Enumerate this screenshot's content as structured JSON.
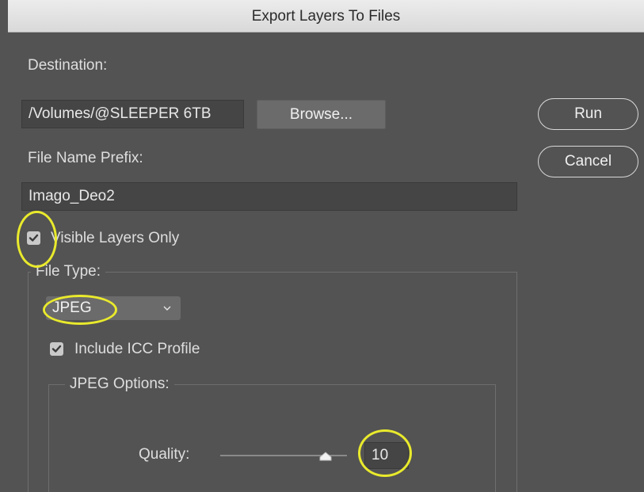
{
  "window": {
    "title": "Export Layers To Files"
  },
  "destination": {
    "label": "Destination:",
    "path_value": "/Volumes/@SLEEPER 6TB",
    "browse_label": "Browse..."
  },
  "actions": {
    "run_label": "Run",
    "cancel_label": "Cancel"
  },
  "file_name_prefix": {
    "label": "File Name Prefix:",
    "value": "Imago_Deo2"
  },
  "visible_layers_only": {
    "label": "Visible Layers Only",
    "checked": true
  },
  "file_type": {
    "group_label": "File Type:",
    "selected": "JPEG",
    "dropdown_icon": "chevron-down-icon"
  },
  "include_icc_profile": {
    "label": "Include ICC Profile",
    "checked": true
  },
  "jpeg_options": {
    "group_label": "JPEG Options:",
    "quality_label": "Quality:",
    "quality_value": "10",
    "quality_min": 0,
    "quality_max": 12,
    "quality_level": 10
  },
  "annotations": {
    "highlight_color": "#e9ea2c"
  }
}
